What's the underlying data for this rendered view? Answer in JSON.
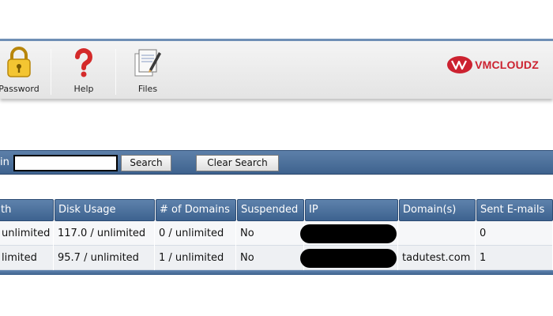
{
  "toolbar": {
    "items": [
      {
        "label": "Password",
        "icon": "lock-icon"
      },
      {
        "label": "Help",
        "icon": "question-mark-icon"
      },
      {
        "label": "Files",
        "icon": "files-icon"
      }
    ],
    "logo": {
      "brand": "VMCLOUDZ",
      "mark": "VM",
      "color": "#cc2230"
    }
  },
  "search": {
    "label": "in",
    "value": "",
    "search_button": "Search",
    "clear_button": "Clear Search"
  },
  "table": {
    "columns": [
      "th",
      "Disk Usage",
      "# of Domains",
      "Suspended",
      "IP",
      "Domain(s)",
      "Sent E-mails"
    ],
    "rows": [
      {
        "bandwidth": "unlimited",
        "disk": "117.0 / unlimited",
        "domains": "0 / unlimited",
        "suspended": "No",
        "ip": "",
        "domain": "",
        "sent": "0"
      },
      {
        "bandwidth": "limited",
        "disk": "95.7 / unlimited",
        "domains": "1 / unlimited",
        "suspended": "No",
        "ip": "",
        "domain": "tadutest.com",
        "sent": "1"
      }
    ]
  },
  "colors": {
    "header_blue": "#4a6e99",
    "brand_red": "#cc2230"
  }
}
